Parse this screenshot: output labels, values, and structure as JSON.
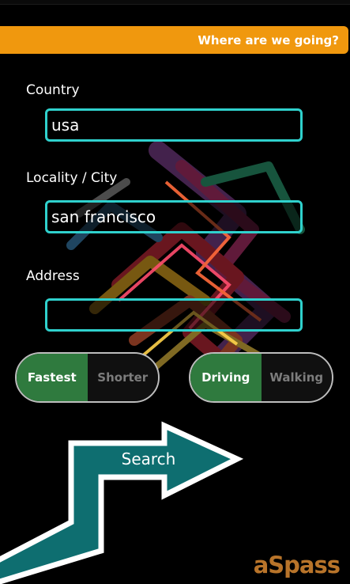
{
  "header": {
    "title": "Where are we going?"
  },
  "form": {
    "country": {
      "label": "Country",
      "value": "usa"
    },
    "city": {
      "label": "Locality / City",
      "value": "san francisco"
    },
    "address": {
      "label": "Address",
      "value": ""
    }
  },
  "route_toggle": {
    "option_1": "Fastest",
    "option_2": "Shorter",
    "selected": "Fastest"
  },
  "mode_toggle": {
    "option_1": "Driving",
    "option_2": "Walking",
    "selected": "Driving"
  },
  "search": {
    "label": "Search"
  },
  "logo": {
    "text": "aSpass"
  },
  "colors": {
    "header": "#f0980e",
    "input_border": "#2fd1cd",
    "toggle_active": "#2f7a3e",
    "arrow": "#0e6e70",
    "logo": "#b8742a"
  }
}
